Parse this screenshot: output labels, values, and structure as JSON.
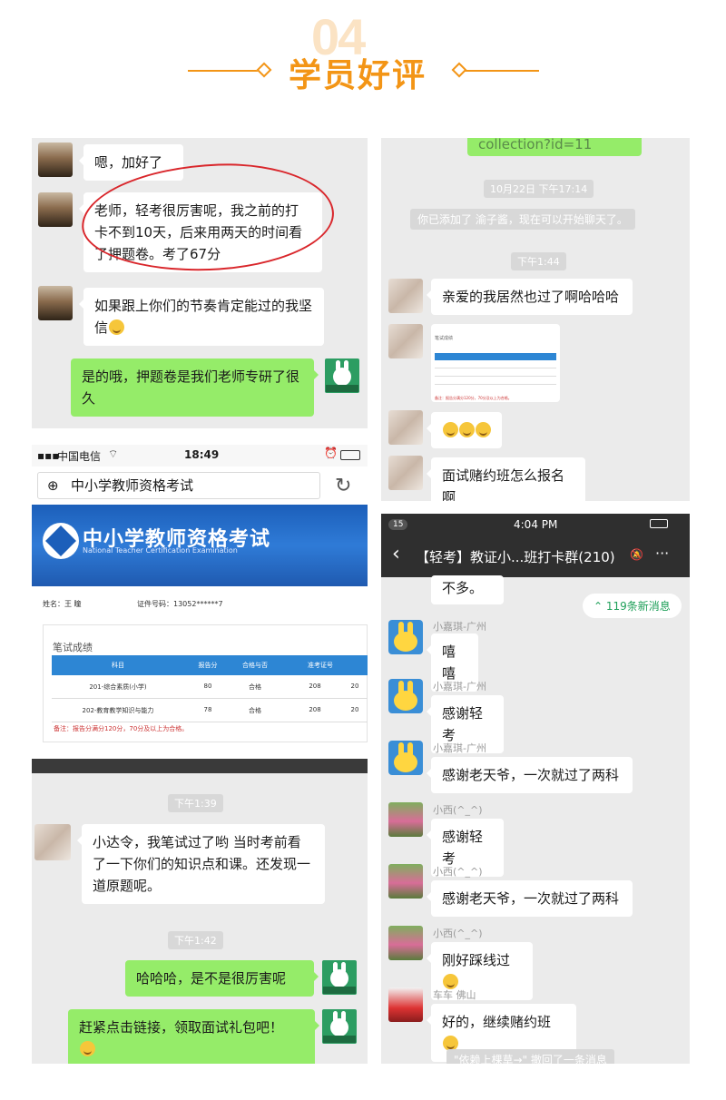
{
  "header": {
    "number": "04",
    "title": "学员好评"
  },
  "p1": {
    "msgs": [
      "嗯，加好了",
      "老师，轻考很厉害呢，我之前的打卡不到10天，后来用两天的时间看了押题卷。考了67分",
      "如果跟上你们的节奏肯定能过的我坚信",
      "是的哦，押题卷是我们老师专研了很久"
    ]
  },
  "p2": {
    "link_text": "collection?id=11",
    "time1": "10月22日 下午17:14",
    "sys": "你已添加了 渝子酱，现在可以开始聊天了。",
    "time2": "下午1:44",
    "msg1": "亲爱的我居然也过了啊哈哈哈",
    "mini_title": "笔试成绩",
    "mini_note": "备注：报告分满分120分，70分及以上为合格。",
    "msg3": "面试赌约班怎么报名啊"
  },
  "p3": {
    "carrier": "中国电信",
    "clock": "18:49",
    "url_title": "中小学教师资格考试",
    "banner_title": "中小学教师资格考试",
    "banner_sub": "National Teacher Certification Examination",
    "name_label": "姓名：",
    "name_value": "王 瞳",
    "id_label": "证件号码：",
    "id_value": "13052******7",
    "section_title": "笔试成绩",
    "headers": [
      "科目",
      "报告分",
      "合格与否",
      "准考证号",
      ""
    ],
    "rows": [
      [
        "201-综合素质(小学)",
        "80",
        "合格",
        "208",
        "20"
      ],
      [
        "202-教育教学知识与能力",
        "78",
        "合格",
        "208",
        "20"
      ]
    ],
    "note": "备注：报告分满分120分，70分及以上为合格。"
  },
  "p4": {
    "time1": "下午1:39",
    "msg1": "小达令，我笔试过了哟 当时考前看了一下你们的知识点和课。还发现一道原题呢。",
    "time2": "下午1:42",
    "msg2": "哈哈哈，是不是很厉害呢",
    "msg3": "赶紧点击链接，领取面试礼包吧！"
  },
  "p5": {
    "status_badge": "15",
    "clock": "4:04 PM",
    "title": "【轻考】教证小...班打卡群(210)",
    "more": "···",
    "first": "不多。",
    "unread": "119条新消息",
    "msgs": [
      {
        "sender": "小嘉琪-广州",
        "text": "嘻嘻"
      },
      {
        "sender": "小嘉琪-广州",
        "text": "感谢轻考"
      },
      {
        "sender": "小嘉琪-广州",
        "text": "感谢老天爷，一次就过了两科"
      },
      {
        "sender": "小西(^_^)",
        "text": "感谢轻考"
      },
      {
        "sender": "小西(^_^)",
        "text": "感谢老天爷，一次就过了两科"
      },
      {
        "sender": "小西(^_^)",
        "text": "刚好踩线过"
      },
      {
        "sender": "车车 佛山",
        "text": "好的，继续赌约班"
      }
    ],
    "recall": "\"依赖上棵草→\" 撤回了一条消息"
  }
}
